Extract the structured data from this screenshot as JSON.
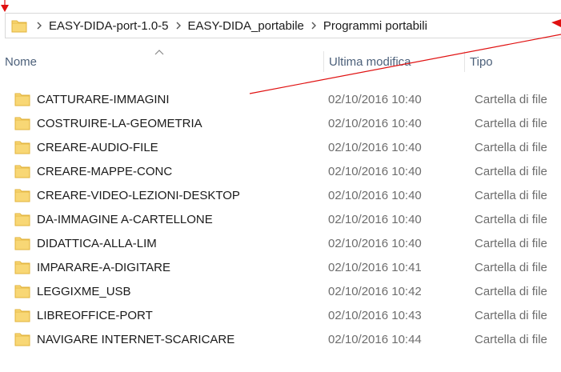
{
  "breadcrumb": {
    "items": [
      {
        "label": "EASY-DIDA-port-1.0-5"
      },
      {
        "label": "EASY-DIDA_portabile"
      },
      {
        "label": "Programmi portabili"
      }
    ]
  },
  "columns": {
    "name": "Nome",
    "modified": "Ultima modifica",
    "type": "Tipo"
  },
  "files": [
    {
      "name": "CATTURARE-IMMAGINI",
      "modified": "02/10/2016 10:40",
      "type": "Cartella di file"
    },
    {
      "name": "COSTRUIRE-LA-GEOMETRIA",
      "modified": "02/10/2016 10:40",
      "type": "Cartella di file"
    },
    {
      "name": "CREARE-AUDIO-FILE",
      "modified": "02/10/2016 10:40",
      "type": "Cartella di file"
    },
    {
      "name": "CREARE-MAPPE-CONC",
      "modified": "02/10/2016 10:40",
      "type": "Cartella di file"
    },
    {
      "name": "CREARE-VIDEO-LEZIONI-DESKTOP",
      "modified": "02/10/2016 10:40",
      "type": "Cartella di file"
    },
    {
      "name": "DA-IMMAGINE A-CARTELLONE",
      "modified": "02/10/2016 10:40",
      "type": "Cartella di file"
    },
    {
      "name": "DIDATTICA-ALLA-LIM",
      "modified": "02/10/2016 10:40",
      "type": "Cartella di file"
    },
    {
      "name": "IMPARARE-A-DIGITARE",
      "modified": "02/10/2016 10:41",
      "type": "Cartella di file"
    },
    {
      "name": "LEGGIXME_USB",
      "modified": "02/10/2016 10:42",
      "type": "Cartella di file"
    },
    {
      "name": "LIBREOFFICE-PORT",
      "modified": "02/10/2016 10:43",
      "type": "Cartella di file"
    },
    {
      "name": "NAVIGARE INTERNET-SCARICARE",
      "modified": "02/10/2016 10:44",
      "type": "Cartella di file"
    }
  ],
  "colors": {
    "folder_fill": "#f8d775",
    "folder_stroke": "#e2b33c",
    "header_text": "#4c607a",
    "annotation_line": "#e01010"
  },
  "icons": {
    "address_folder": "folder-icon",
    "separator": "chevron-right-icon",
    "sort": "sort-up-caret-icon",
    "row": "folder-icon"
  }
}
